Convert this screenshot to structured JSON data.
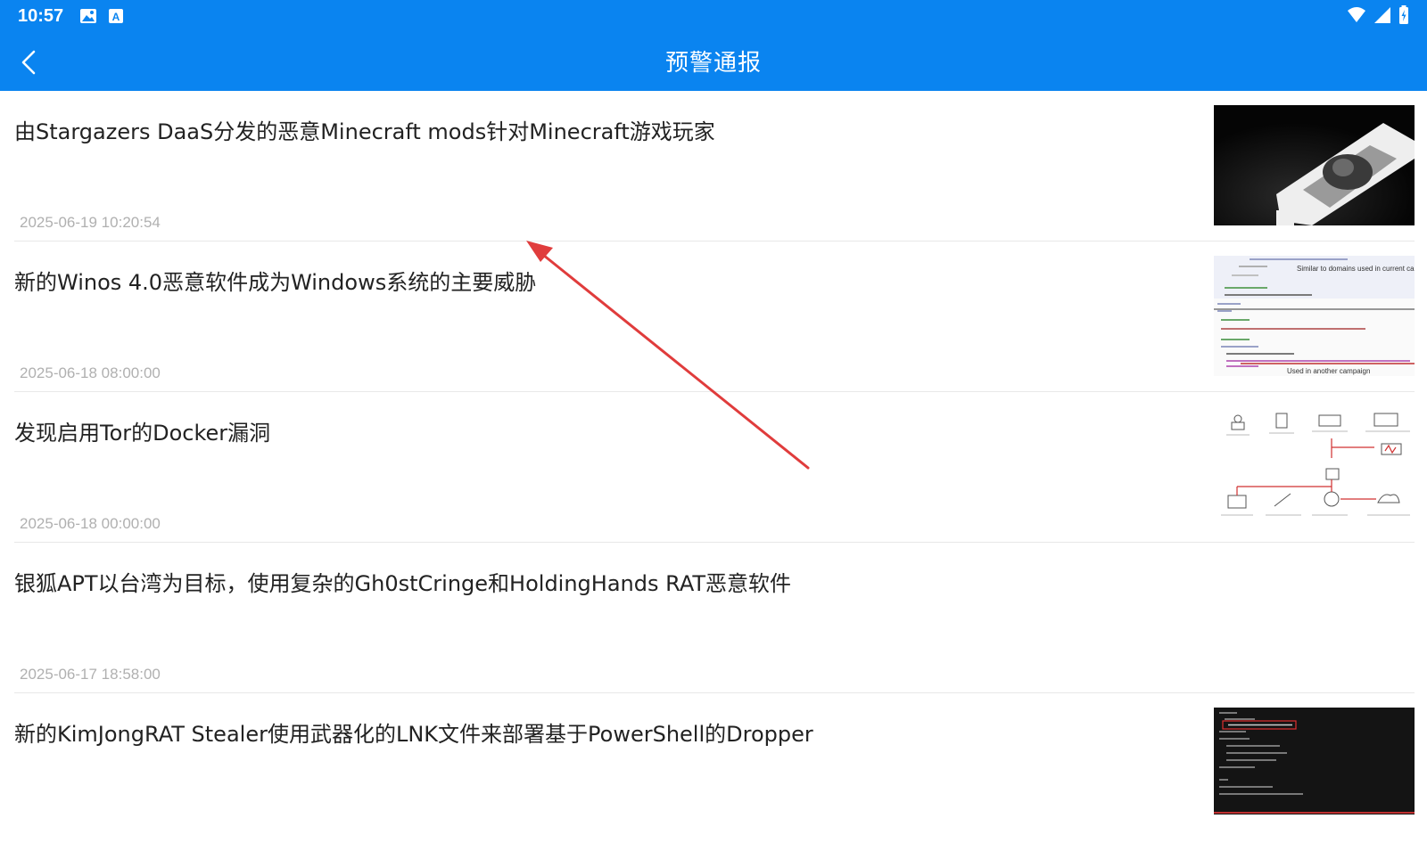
{
  "status_bar": {
    "time": "10:57",
    "left_icons": [
      "image-icon",
      "a-badge-icon"
    ],
    "right_icons": [
      "wifi-icon",
      "signal-icon",
      "battery-icon"
    ]
  },
  "app_bar": {
    "title": "预警通报",
    "back_icon": "chevron-left-icon"
  },
  "colors": {
    "primary": "#0a84f0",
    "date_text": "#b0b0b0",
    "annotation_arrow": "#e03c3c"
  },
  "articles": [
    {
      "title": "由Stargazers DaaS分发的恶意Minecraft mods针对Minecraft游戏玩家",
      "date": "2025-06-19 10:20:54",
      "thumbnail": "photo-thumb"
    },
    {
      "title": "新的Winos 4.0恶意软件成为Windows系统的主要威胁",
      "date": "2025-06-18 08:00:00",
      "thumbnail": "code-thumb",
      "thumb_text": {
        "top": "Similar to domains used in current campaign",
        "bottom": "Used in another campaign"
      }
    },
    {
      "title": "发现启用Tor的Docker漏洞",
      "date": "2025-06-18 00:00:00",
      "thumbnail": "diagram-thumb"
    },
    {
      "title": "银狐APT以台湾为目标，使用复杂的Gh0stCringe和HoldingHands RAT恶意软件",
      "date": "2025-06-17 18:58:00",
      "thumbnail": ""
    },
    {
      "title": "新的KimJongRAT Stealer使用武器化的LNK文件来部署基于PowerShell的Dropper",
      "date": "",
      "thumbnail": "terminal-thumb"
    }
  ]
}
